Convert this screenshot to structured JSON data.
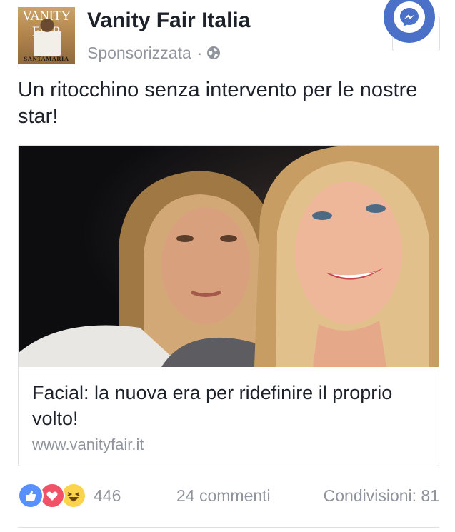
{
  "post": {
    "page_name": "Vanity Fair Italia",
    "sponsored_label": "Sponsorizzata",
    "separator": "·",
    "privacy_icon": "globe-icon",
    "thumbnail": {
      "masthead": "VANITY FAIR",
      "cover_name": "SANTAMARIA"
    },
    "message": "Un ritocchino senza intervento per le nostre star!",
    "link": {
      "title": "Facial: la nuova era per ridefinire il proprio volto!",
      "domain": "www.vanityfair.it"
    },
    "reactions": {
      "icons": [
        "like-icon",
        "love-icon",
        "haha-icon"
      ],
      "count": "446"
    },
    "comments_label": "24 commenti",
    "shares_label": "Condivisioni: 81"
  },
  "messenger": {
    "icon": "messenger-icon"
  },
  "colors": {
    "messenger_blue": "#4b70c7",
    "like_blue": "#5890ff",
    "love_red": "#f25268",
    "haha_yellow": "#fcd34d",
    "muted_text": "#90949c",
    "border": "#dddfe2"
  }
}
